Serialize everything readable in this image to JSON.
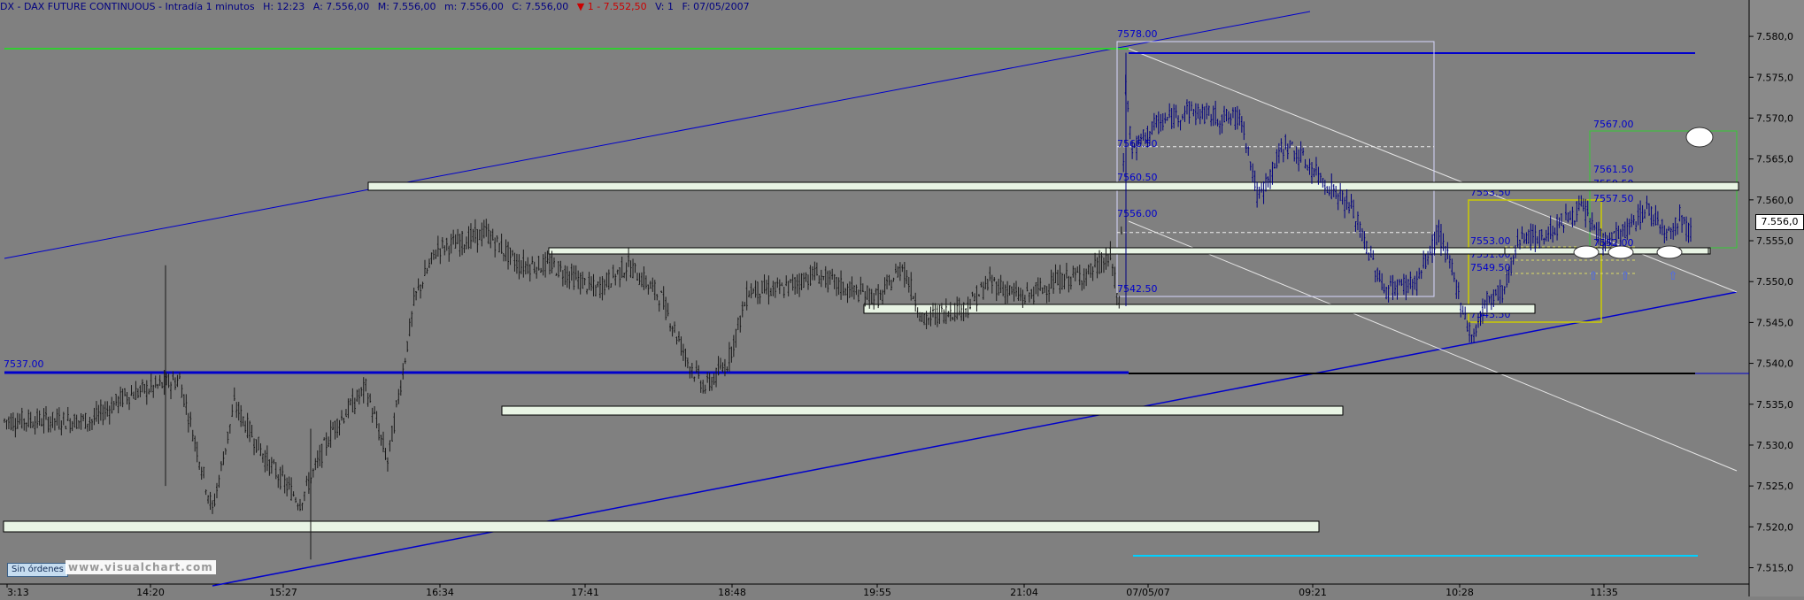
{
  "header": {
    "symbol": "DX - DAX FUTURE CONTINUOUS - Intradía 1 minutos",
    "h": "H: 12:23",
    "a": "A: 7.556,00",
    "m": "M: 7.556,00",
    "m2": "m: 7.556,00",
    "c": "C: 7.556,00",
    "change": "▼ 1 - 7.552,50",
    "v": "V: 1",
    "f": "F: 07/05/2007"
  },
  "status": {
    "orders_label": "Sin órdenes",
    "watermark": "www.visualchart.com"
  },
  "colors": {
    "background": "#808080",
    "candle": "#1a1a1a",
    "candle_day2": "#00007f",
    "channel": "#0000cc",
    "support_line": "#0000cc",
    "top_line": "#33cc33",
    "zone_fill": "#e8f4e4",
    "white_lines": "#e6e6e6",
    "fib_box": "#d8d8ff",
    "cyan_line": "#00d0ff"
  },
  "chart_data": {
    "type": "candlestick",
    "title": "DX - DAX FUTURE CONTINUOUS - Intradía 1 minutos",
    "y_range": [
      7513.0,
      7582.5
    ],
    "y_ticks": [
      7515.0,
      7520.0,
      7525.0,
      7530.0,
      7535.0,
      7540.0,
      7545.0,
      7550.0,
      7555.0,
      7560.0,
      7565.0,
      7570.0,
      7575.0,
      7580.0
    ],
    "y_tick_labels": [
      "7.515,0",
      "7.520,0",
      "7.525,0",
      "7.530,0",
      "7.535,0",
      "7.540,0",
      "7.545,0",
      "7.550,0",
      "7.555,0",
      "7.560,0",
      "7.565,0",
      "7.570,0",
      "7.575,0",
      "7.580,0"
    ],
    "x_ticks": [
      "3:13",
      "14:20",
      "15:27",
      "16:34",
      "17:41",
      "18:48",
      "19:55",
      "21:04",
      "07/05/07",
      "09:21",
      "10:28",
      "11:35"
    ],
    "last_price": "7.556,0",
    "close_path": [
      [
        0,
        7533
      ],
      [
        80,
        7533
      ],
      [
        110,
        7536
      ],
      [
        160,
        7538
      ],
      [
        190,
        7522
      ],
      [
        210,
        7535
      ],
      [
        240,
        7528
      ],
      [
        270,
        7523
      ],
      [
        300,
        7532
      ],
      [
        330,
        7537
      ],
      [
        350,
        7528
      ],
      [
        375,
        7548
      ],
      [
        395,
        7554
      ],
      [
        420,
        7555
      ],
      [
        440,
        7556
      ],
      [
        470,
        7552
      ],
      [
        500,
        7552
      ],
      [
        540,
        7549
      ],
      [
        570,
        7552
      ],
      [
        600,
        7548
      ],
      [
        625,
        7540
      ],
      [
        640,
        7537
      ],
      [
        660,
        7540
      ],
      [
        680,
        7549
      ],
      [
        710,
        7549
      ],
      [
        740,
        7551
      ],
      [
        770,
        7549
      ],
      [
        800,
        7548
      ],
      [
        820,
        7552
      ],
      [
        840,
        7545
      ],
      [
        850,
        7546
      ],
      [
        880,
        7547
      ],
      [
        900,
        7550
      ],
      [
        930,
        7548
      ],
      [
        960,
        7550
      ],
      [
        990,
        7551
      ],
      [
        1010,
        7553
      ],
      [
        1018,
        7547
      ],
      [
        1024,
        7574
      ],
      [
        1030,
        7566
      ],
      [
        1050,
        7569
      ],
      [
        1080,
        7571
      ],
      [
        1110,
        7570
      ],
      [
        1130,
        7570
      ],
      [
        1145,
        7560
      ],
      [
        1170,
        7567
      ],
      [
        1200,
        7563
      ],
      [
        1230,
        7559
      ],
      [
        1260,
        7549
      ],
      [
        1290,
        7550
      ],
      [
        1310,
        7556
      ],
      [
        1325,
        7550
      ],
      [
        1340,
        7543
      ],
      [
        1355,
        7548
      ],
      [
        1370,
        7549
      ],
      [
        1385,
        7556
      ],
      [
        1400,
        7555
      ],
      [
        1420,
        7557
      ],
      [
        1440,
        7559
      ],
      [
        1460,
        7555
      ],
      [
        1480,
        7556
      ],
      [
        1500,
        7559
      ],
      [
        1520,
        7556
      ],
      [
        1530,
        7558
      ],
      [
        1540,
        7556
      ]
    ]
  },
  "levels": {
    "open_day2": "7578.00",
    "l_7566": "7566.50",
    "l_7560": "7560.50",
    "l_7556": "7556.00",
    "l_7542": "7542.50",
    "l_7537": "7537.00",
    "l_7553a": "7553.50",
    "l_7553b": "7553.00",
    "l_7551": "7551.00",
    "l_7549": "7549.50",
    "l_7543": "7543.50",
    "l_7567": "7567.00",
    "l_7561": "7561.50",
    "l_7559": "7559.50",
    "l_7557": "7557.50",
    "l_7552": "7552.00"
  }
}
